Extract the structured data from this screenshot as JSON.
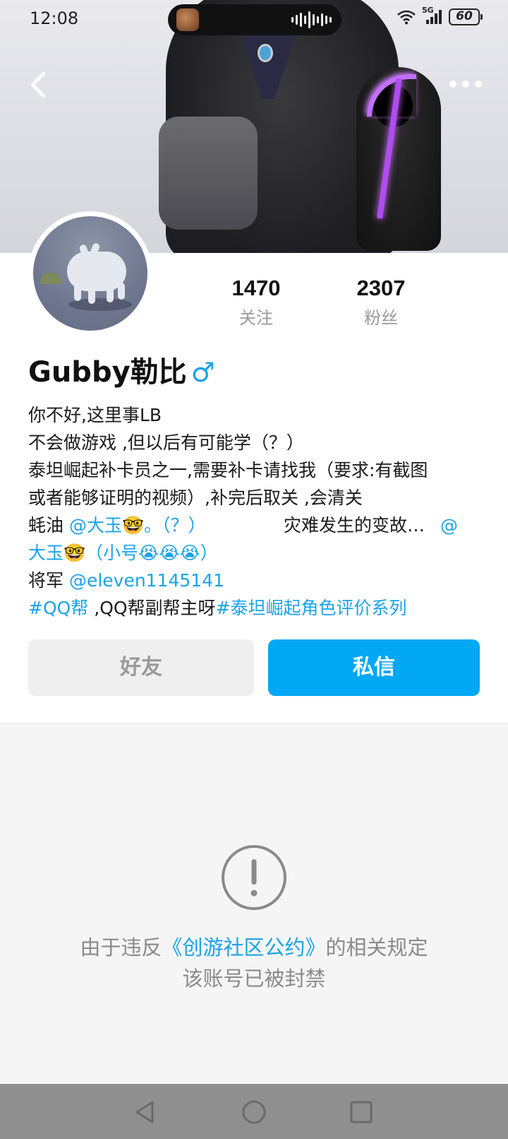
{
  "status_bar": {
    "time": "12:08",
    "network": "5G",
    "battery": "60"
  },
  "header": {
    "back_icon": "chevron-left-icon",
    "more_icon": "more-dots-icon"
  },
  "profile": {
    "following_count": "1470",
    "following_label": "关注",
    "followers_count": "2307",
    "followers_label": "粉丝",
    "username": "Gubby勒比",
    "gender_symbol": "♂"
  },
  "bio": {
    "line1": "你不好,这里事LB",
    "line2": "不会做游戏 ,但以后有可能学（？）",
    "line3": "泰坦崛起补卡员之一,需要补卡请找我（要求:有截图",
    "line4": "或者能够证明的视频）,补完后取关 ,会清关",
    "line5_prefix": "蚝油 ",
    "line5_mention": "@大玉🤓。（？）",
    "line5_middle": "灾难发生的变故… ",
    "line5_mention2": "@",
    "line6_mention": "大玉🤓（小号😭😭😭）",
    "line7_prefix": "将军 ",
    "line7_mention": "@eleven1145141",
    "line8_tag1": " #QQ帮",
    "line8_text": " ,QQ帮副帮主呀",
    "line8_tag2": "#泰坦崛起角色评价系列"
  },
  "actions": {
    "friend_label": "好友",
    "message_label": "私信"
  },
  "banned": {
    "prefix": "由于违反",
    "link": "《创游社区公约》",
    "suffix": "的相关规定",
    "line2": "该账号已被封禁"
  },
  "colors": {
    "accent": "#02a8f4",
    "link": "#1aa3e8",
    "muted": "#8a8a8a"
  }
}
